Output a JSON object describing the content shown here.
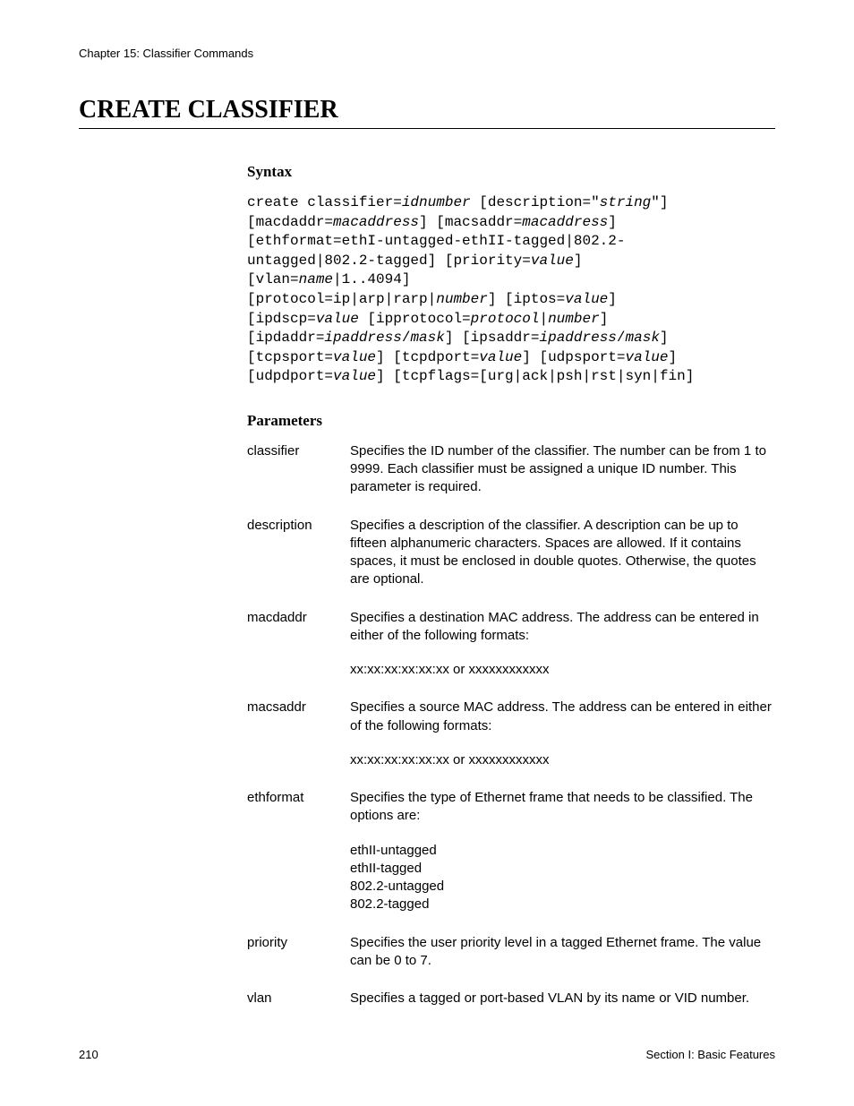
{
  "header": {
    "chapter": "Chapter 15: Classifier Commands"
  },
  "title": "CREATE CLASSIFIER",
  "syntax": {
    "heading": "Syntax",
    "line1a": "create classifier=",
    "line1b": "idnumber",
    "line1c": " [description=\"",
    "line1d": "string",
    "line1e": "\"]",
    "line2a": "[macdaddr=",
    "line2b": "macaddress",
    "line2c": "] [macsaddr=",
    "line2d": "macaddress",
    "line2e": "]",
    "line3": "[ethformat=ethI-untagged-ethII-tagged|802.2-",
    "line4a": "untagged|802.2-tagged] [priority=",
    "line4b": "value",
    "line4c": "]",
    "line5a": "[vlan=",
    "line5b": "name",
    "line5c": "|1..4094]",
    "line6a": "[protocol=ip|arp|rarp|",
    "line6b": "number",
    "line6c": "] [iptos=",
    "line6d": "value",
    "line6e": "]",
    "line7a": "[ipdscp=",
    "line7b": "value",
    "line7c": " [ipprotocol=",
    "line7d": "protocol",
    "line7e": "|",
    "line7f": "number",
    "line7g": "]",
    "line8a": "[ipdaddr=",
    "line8b": "ipaddress",
    "line8c": "/",
    "line8d": "mask",
    "line8e": "] [ipsaddr=",
    "line8f": "ipaddress",
    "line8g": "/",
    "line8h": "mask",
    "line8i": "]",
    "line9a": "[tcpsport=",
    "line9b": "value",
    "line9c": "] [tcpdport=",
    "line9d": "value",
    "line9e": "] [udpsport=",
    "line9f": "value",
    "line9g": "]",
    "line10a": "[udpdport=",
    "line10b": "value",
    "line10c": "] [tcpflags=[urg|ack|psh|rst|syn|fin]"
  },
  "parameters": {
    "heading": "Parameters",
    "rows": [
      {
        "name": "classifier",
        "desc": [
          "Specifies the ID number of the classifier. The number can be from 1 to 9999. Each classifier must be assigned a unique ID number. This parameter is required."
        ]
      },
      {
        "name": "description",
        "desc": [
          "Specifies a description of the classifier. A description can be up to fifteen alphanumeric characters. Spaces are allowed. If it contains spaces, it must be enclosed in double quotes. Otherwise, the quotes are optional."
        ]
      },
      {
        "name": "macdaddr",
        "desc": [
          "Specifies a destination MAC address. The address can be entered in either of the following formats:",
          "xx:xx:xx:xx:xx:xx or xxxxxxxxxxxx"
        ]
      },
      {
        "name": "macsaddr",
        "desc": [
          "Specifies a source MAC address. The address can be entered in either of the following formats:",
          "xx:xx:xx:xx:xx:xx or xxxxxxxxxxxx"
        ]
      },
      {
        "name": "ethformat",
        "desc": [
          "Specifies the type of Ethernet frame that needs to be classified. The options are:",
          "ethII-untagged\nethII-tagged\n802.2-untagged\n802.2-tagged"
        ]
      },
      {
        "name": "priority",
        "desc": [
          "Specifies the user priority level in a tagged Ethernet frame. The value can be 0 to 7."
        ]
      },
      {
        "name": "vlan",
        "desc": [
          "Specifies a tagged or port-based VLAN by its name or VID number."
        ]
      }
    ]
  },
  "footer": {
    "page": "210",
    "section": "Section I: Basic Features"
  }
}
